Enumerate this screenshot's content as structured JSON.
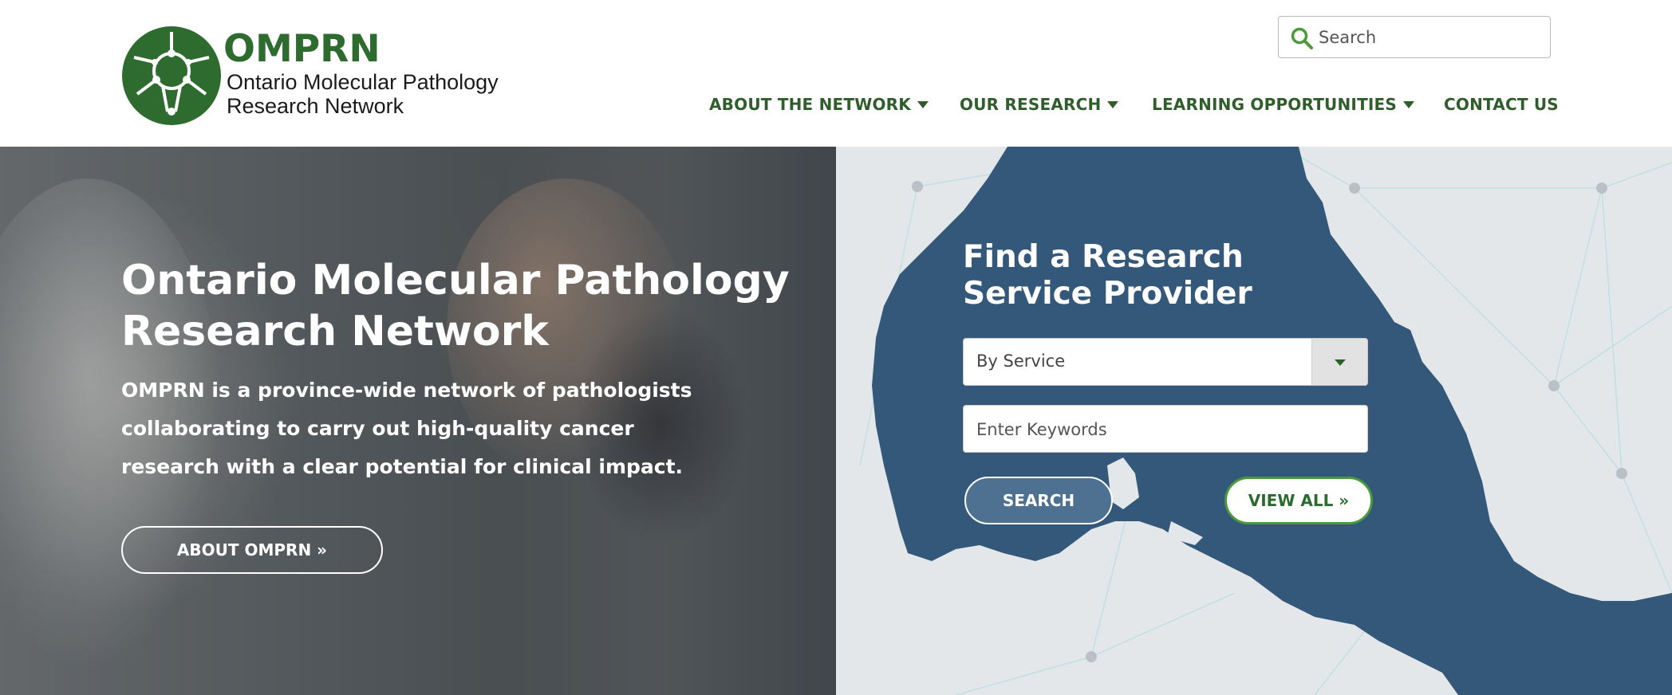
{
  "brand": {
    "acronym": "OMPRN",
    "name_line1": "Ontario Molecular Pathology",
    "name_line2": "Research Network",
    "logo_icon": "network-molecule-icon",
    "primary_green": "#2e6b2f",
    "accent_green": "#4a9a3b"
  },
  "search": {
    "placeholder": "Search",
    "icon": "search-icon"
  },
  "nav": {
    "items": [
      {
        "label": "ABOUT THE NETWORK",
        "has_dropdown": true
      },
      {
        "label": "OUR RESEARCH",
        "has_dropdown": true
      },
      {
        "label": "LEARNING OPPORTUNITIES",
        "has_dropdown": true
      },
      {
        "label": "CONTACT US",
        "has_dropdown": false
      }
    ]
  },
  "hero": {
    "title_line1": "Ontario Molecular Pathology",
    "title_line2": "Research Network",
    "description": "OMPRN is a province-wide network of pathologists collaborating to carry out high-quality cancer research with a clear potential for clinical impact.",
    "about_button": "ABOUT OMPRN »"
  },
  "finder": {
    "title_line1": "Find a Research",
    "title_line2": "Service Provider",
    "select_value": "By Service",
    "keywords_placeholder": "Enter Keywords",
    "search_button": "SEARCH",
    "view_all_button": "VIEW ALL »",
    "map_color": "#34587a",
    "map_background": "#e4e7e9"
  }
}
